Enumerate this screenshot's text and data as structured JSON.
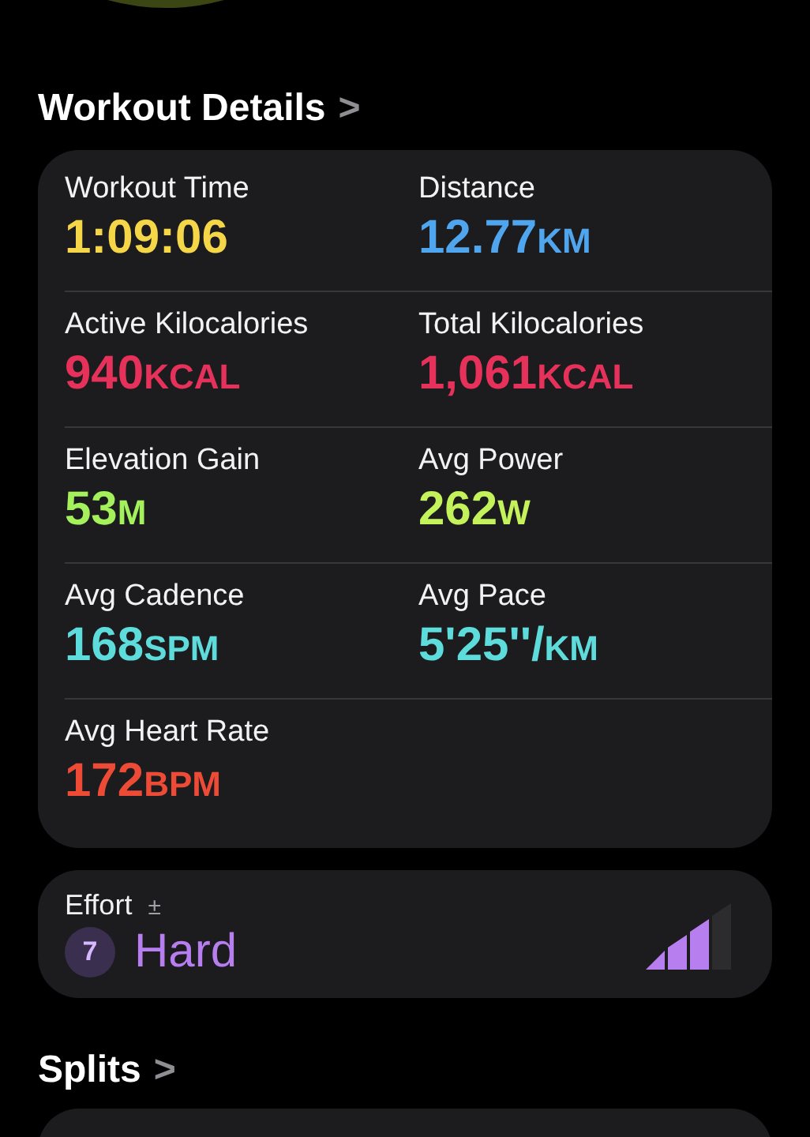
{
  "workout_details": {
    "title": "Workout Details",
    "chevron": ">",
    "metrics": [
      {
        "label": "Workout Time",
        "value": "1:09:06",
        "color": "#f4d648"
      },
      {
        "label": "Distance",
        "value": "12.77",
        "unit": "KM",
        "color": "#50a6ee"
      },
      {
        "label": "Active Kilocalories",
        "value": "940",
        "unit": "KCAL",
        "color": "#e6325a"
      },
      {
        "label": "Total Kilocalories",
        "value": "1,061",
        "unit": "KCAL",
        "color": "#e6325a"
      },
      {
        "label": "Elevation Gain",
        "value": "53",
        "unit": "M",
        "color": "#a4f15c"
      },
      {
        "label": "Avg Power",
        "value": "262",
        "unit": "W",
        "color": "#c4f25a"
      },
      {
        "label": "Avg Cadence",
        "value": "168",
        "unit": "SPM",
        "color": "#5edcdc"
      },
      {
        "label": "Avg Pace",
        "value": "5'25''/",
        "unit": "KM",
        "color": "#5edcdc"
      },
      {
        "label": "Avg Heart Rate",
        "value": "172",
        "unit": "BPM",
        "color": "#ee4b36"
      }
    ]
  },
  "effort": {
    "label": "Effort",
    "adjust": "±",
    "score": "7",
    "rating": "Hard",
    "level": 0.75
  },
  "splits": {
    "title": "Splits",
    "chevron": ">"
  }
}
